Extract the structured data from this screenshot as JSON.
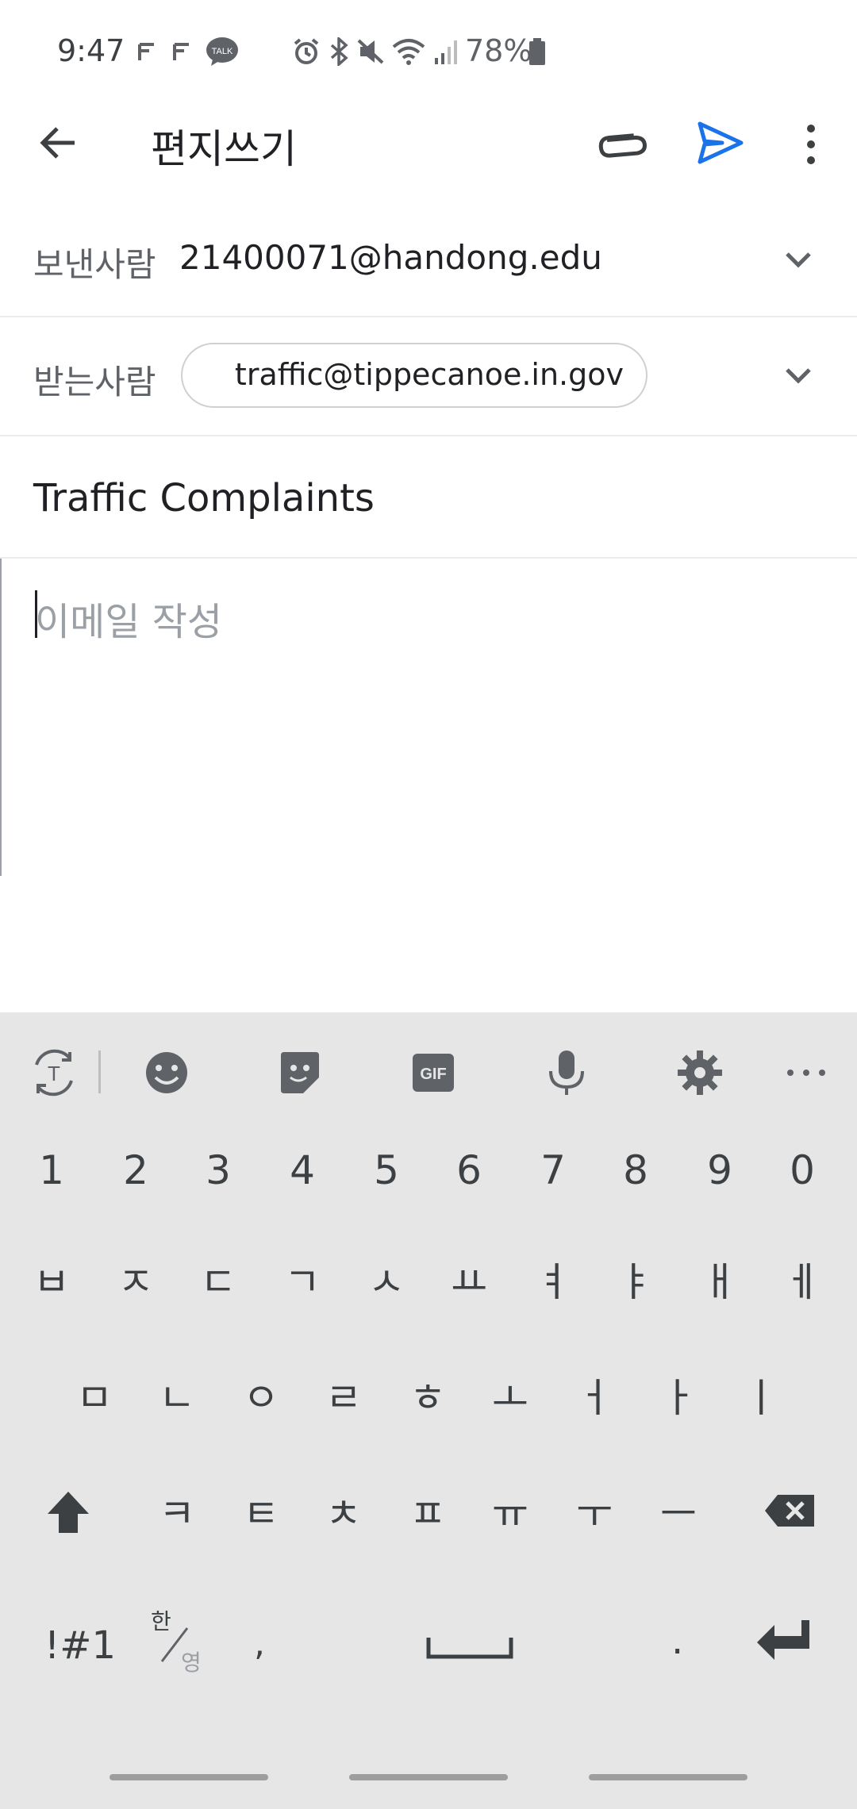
{
  "status": {
    "time": "9:47",
    "battery": "78%",
    "notification_icons": [
      "f-icon",
      "f-icon",
      "kakaotalk-icon"
    ],
    "system_icons": [
      "alarm-icon",
      "bluetooth-icon",
      "mute-icon",
      "wifi-icon",
      "signal-icon",
      "battery-icon"
    ]
  },
  "appbar": {
    "title": "편지쓰기",
    "accent": "#1a73e8"
  },
  "compose": {
    "from_label": "보낸사람",
    "from_value": "21400071@handong.edu",
    "to_label": "받는사람",
    "to_chip": "traffic@tippecanoe.in.gov",
    "subject": "Traffic Complaints",
    "body_placeholder": "이메일 작성"
  },
  "keyboard": {
    "toolbar_icons": [
      "translate-icon",
      "emoji-icon",
      "sticker-icon",
      "gif-icon",
      "mic-icon",
      "settings-icon",
      "more-icon"
    ],
    "numbers": [
      "1",
      "2",
      "3",
      "4",
      "5",
      "6",
      "7",
      "8",
      "9",
      "0"
    ],
    "row1": [
      "ㅂ",
      "ㅈ",
      "ㄷ",
      "ㄱ",
      "ㅅ",
      "ㅛ",
      "ㅕ",
      "ㅑ",
      "ㅐ",
      "ㅔ"
    ],
    "row2": [
      "ㅁ",
      "ㄴ",
      "ㅇ",
      "ㄹ",
      "ㅎ",
      "ㅗ",
      "ㅓ",
      "ㅏ",
      "ㅣ"
    ],
    "row3": [
      "ㅋ",
      "ㅌ",
      "ㅊ",
      "ㅍ",
      "ㅠ",
      "ㅜ",
      "ㅡ"
    ],
    "symbols_label": "!#1",
    "lang_top": "한",
    "lang_bottom": "영",
    "comma": ",",
    "period": "."
  }
}
